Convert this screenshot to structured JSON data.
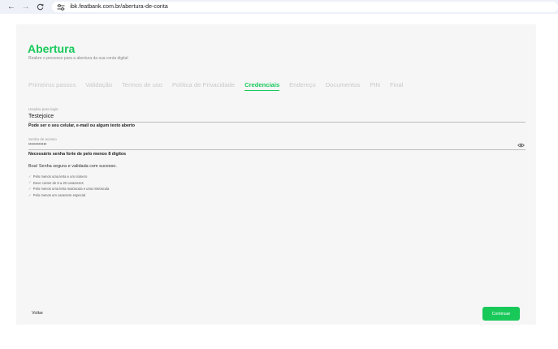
{
  "browser": {
    "url": "ibk.featbank.com.br/abertura-de-conta"
  },
  "page": {
    "title": "Abertura",
    "subtitle": "Realize o processo para a abertura da sua conta digital"
  },
  "steps": [
    {
      "label": "Primeiros passos",
      "active": false
    },
    {
      "label": "Validação",
      "active": false
    },
    {
      "label": "Termos de uso",
      "active": false
    },
    {
      "label": "Política de Privacidade",
      "active": false
    },
    {
      "label": "Credenciais",
      "active": true
    },
    {
      "label": "Endereço",
      "active": false
    },
    {
      "label": "Documentos",
      "active": false
    },
    {
      "label": "PIN",
      "active": false
    },
    {
      "label": "Final",
      "active": false
    }
  ],
  "form": {
    "username": {
      "label": "Usuário para login",
      "value": "Testejoice",
      "hint": "Pode ser o seu celular, e-mail ou algum texto aberto"
    },
    "password": {
      "label": "Senha de acesso",
      "value": "•••••••••••",
      "hint": "Necessário senha forte de pelo menos 8 digitos"
    },
    "success_message": "Boa! Senha segura e validada com sucesso.",
    "rules": [
      "Pelo menos uma letra e um número",
      "Deve conter de 8 a 20 caracteres",
      "Pelo menos uma letra maiúscula e uma minúscula",
      "Pelo menos um caractere especial"
    ]
  },
  "footer": {
    "back_label": "Voltar",
    "continue_label": "Continuar"
  },
  "colors": {
    "accent": "#18c95a",
    "background": "#f6f6f6"
  },
  "icons": [
    "back-arrow-icon",
    "forward-arrow-icon",
    "reload-icon",
    "site-settings-icon",
    "eye-icon",
    "check-icon"
  ]
}
